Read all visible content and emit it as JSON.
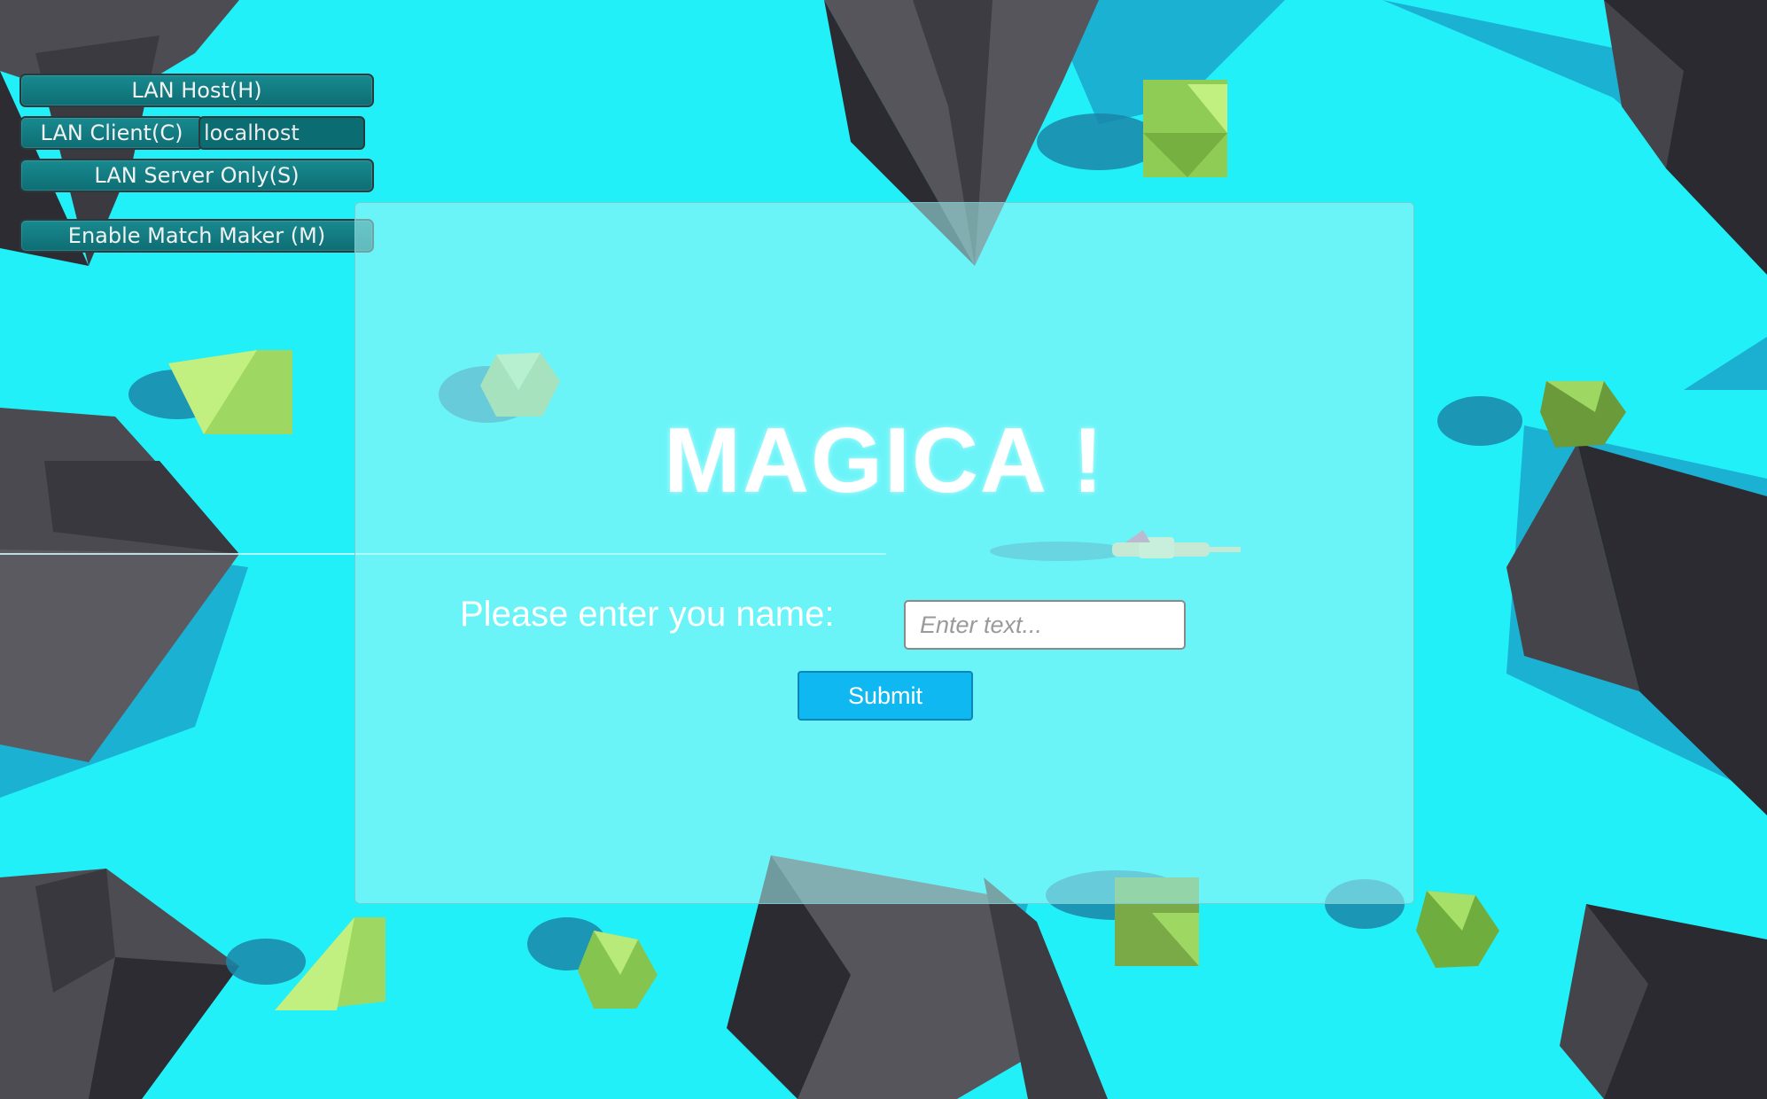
{
  "game": {
    "title": "MAGICA !",
    "prompt_label": "Please enter you name:",
    "name_input_placeholder": "Enter text...",
    "submit_label": "Submit"
  },
  "network_hud": {
    "lan_host_label": "LAN Host(H)",
    "lan_client_label": "LAN Client(C)",
    "client_address_value": "localhost",
    "server_only_label": "LAN Server Only(S)",
    "match_maker_label": "Enable Match Maker (M)"
  },
  "colors": {
    "water": "#22f0f8",
    "rock_light": "#55555b",
    "rock_dark": "#2a2a30",
    "bush_green": "#a8e06a",
    "submit_blue": "#10b8f2"
  },
  "icons": {
    "rocks": "low-poly-rock-icon",
    "bushes": "low-poly-bush-icon",
    "player": "dragon-player-icon"
  }
}
